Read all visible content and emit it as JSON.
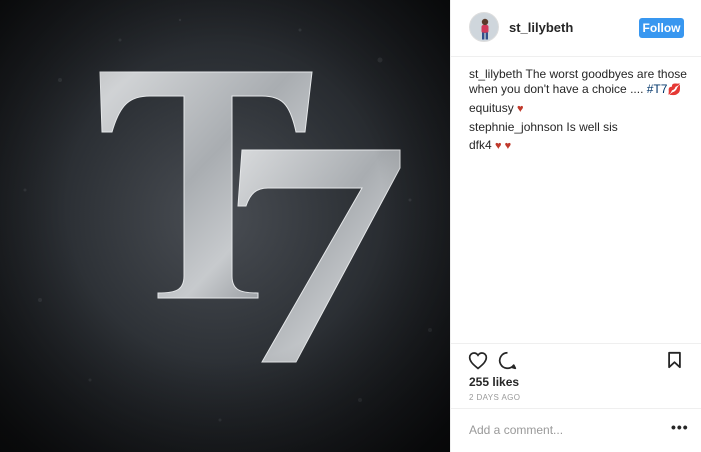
{
  "post": {
    "image": {
      "text": "T7",
      "bg_color": "#2c3035",
      "letter_color": "#b9bdc0"
    },
    "author": {
      "username": "st_lilybeth",
      "avatar_icon": "profile-photo"
    },
    "follow_label": "Follow",
    "caption": {
      "username": "st_lilybeth",
      "text": "The worst goodbyes are those when you don't have a choice .... ",
      "hashtag": "#T7",
      "emoji": "💋"
    },
    "comments": [
      {
        "username": "equitusy",
        "text": "",
        "emoji": "♥"
      },
      {
        "username": "stephnie_johnson",
        "text": "Is well sis",
        "emoji": ""
      },
      {
        "username": "dfk4",
        "text": "",
        "emoji": "♥ ♥"
      }
    ],
    "likes": "255 likes",
    "date": "2 DAYS AGO",
    "comment_placeholder": "Add a comment...",
    "more_label": "•••"
  }
}
